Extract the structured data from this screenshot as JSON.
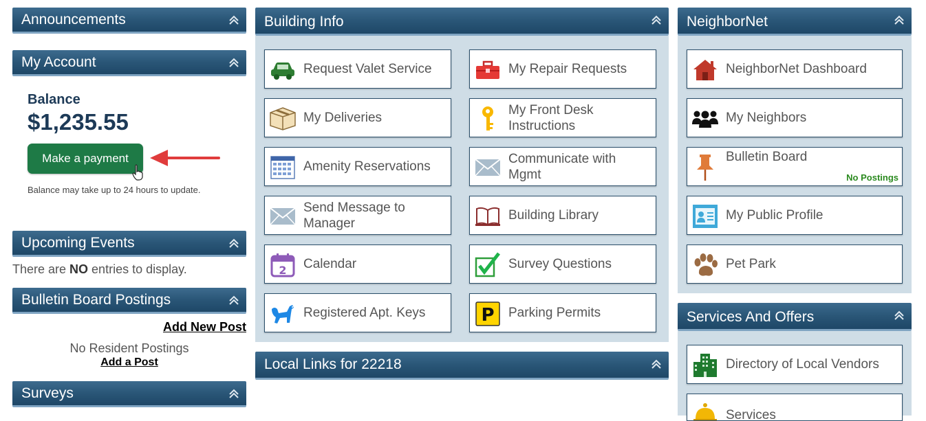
{
  "left": {
    "announcements": {
      "title": "Announcements"
    },
    "account": {
      "title": "My Account",
      "balance_label": "Balance",
      "balance_value": "$1,235.55",
      "pay_button": "Make a payment",
      "note": "Balance may take up to 24 hours to update."
    },
    "events": {
      "title": "Upcoming Events",
      "empty_pre": "There are ",
      "empty_bold": "NO",
      "empty_post": " entries to display."
    },
    "bulletin": {
      "title": "Bulletin Board Postings",
      "add_new": "Add New Post",
      "none": "No Resident Postings",
      "add": "Add a Post"
    },
    "surveys": {
      "title": "Surveys"
    }
  },
  "building": {
    "title": "Building Info",
    "tiles": [
      {
        "label": "Request Valet Service",
        "icon": "car-icon"
      },
      {
        "label": "My Repair Requests",
        "icon": "toolbox-icon"
      },
      {
        "label": "My Deliveries",
        "icon": "package-icon"
      },
      {
        "label": "My Front Desk Instructions",
        "icon": "key-icon"
      },
      {
        "label": "Amenity Reservations",
        "icon": "calendar-grid-icon"
      },
      {
        "label": "Communicate with Mgmt",
        "icon": "envelope-icon"
      },
      {
        "label": "Send Message to Manager",
        "icon": "envelope-icon"
      },
      {
        "label": "Building Library",
        "icon": "book-icon"
      },
      {
        "label": "Calendar",
        "icon": "calendar-icon",
        "day": "2"
      },
      {
        "label": "Survey Questions",
        "icon": "checkmark-icon"
      },
      {
        "label": "Registered Apt. Keys",
        "icon": "dog-icon"
      },
      {
        "label": "Parking Permits",
        "icon": "parking-icon",
        "letter": "P"
      }
    ]
  },
  "local_links": {
    "title": "Local Links for 22218"
  },
  "neighbornet": {
    "title": "NeighborNet",
    "tiles": [
      {
        "label": "NeighborNet Dashboard",
        "icon": "house-icon"
      },
      {
        "label": "My Neighbors",
        "icon": "people-icon"
      },
      {
        "label": "Bulletin Board",
        "icon": "pushpin-icon",
        "badge": "No Postings"
      },
      {
        "label": "My Public Profile",
        "icon": "profile-card-icon"
      },
      {
        "label": "Pet Park",
        "icon": "paw-icon"
      }
    ]
  },
  "services": {
    "title": "Services And Offers",
    "tiles": [
      {
        "label": "Directory of Local Vendors",
        "icon": "building-icon"
      },
      {
        "label": "Services",
        "icon": "bell-icon"
      }
    ]
  },
  "colors": {
    "header": "#2a5677",
    "grid_bg": "#cfdde6",
    "pay_button": "#1e7a46",
    "arrow": "#e03c3c",
    "badge": "#2b8a1f"
  }
}
